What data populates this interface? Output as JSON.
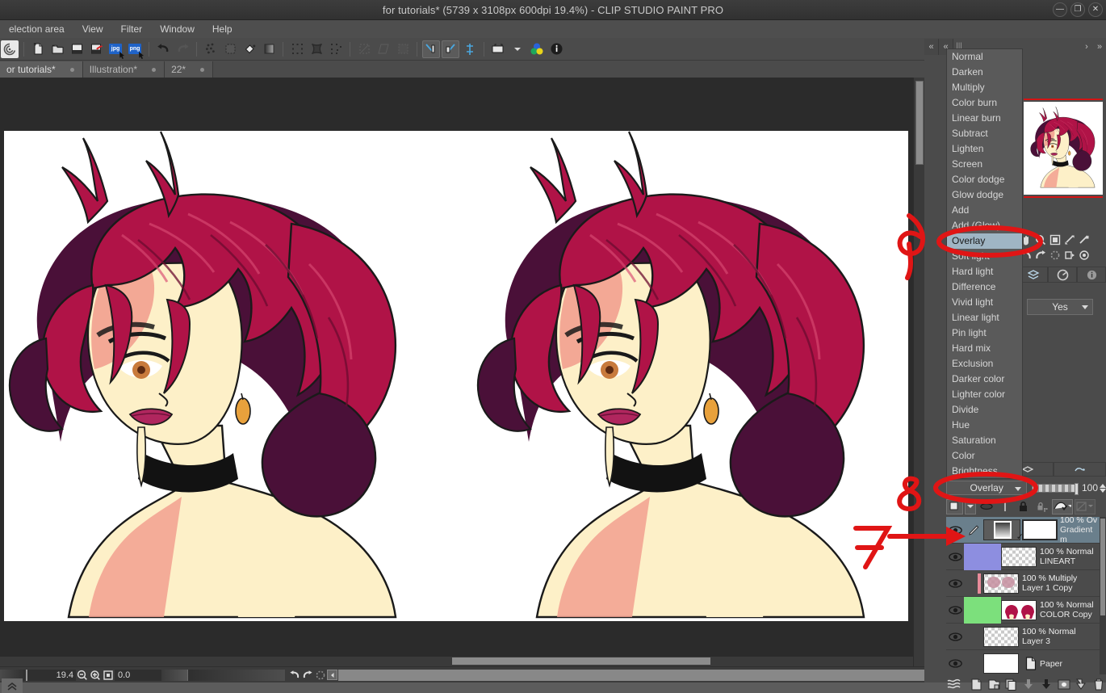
{
  "window": {
    "title": "for tutorials* (5739 x 3108px 600dpi 19.4%)  - CLIP STUDIO PAINT PRO",
    "controls": {
      "minimize": "—",
      "maximize": "❐",
      "close": "✕"
    }
  },
  "menubar": {
    "items": [
      {
        "label": "election area"
      },
      {
        "label": "View"
      },
      {
        "label": "Filter"
      },
      {
        "label": "Window"
      },
      {
        "label": "Help"
      }
    ]
  },
  "commandbar": {
    "icons": [
      "clipstudio-logo-icon",
      "new-file-icon",
      "open-folder-icon",
      "save-icon",
      "save-as-icon",
      "export-jpg-icon",
      "export-png-icon",
      "undo-icon",
      "redo-icon",
      "clear-icon",
      "fill-selection-icon",
      "fill-bucket-icon",
      "gradient-icon",
      "select-all-icon",
      "deselect-icon",
      "invert-selection-icon",
      "shrink-selection-icon",
      "grow-selection-icon",
      "selection-border-icon",
      "flip-horizontal-icon",
      "flip-vertical-icon",
      "ruler-snap-icon",
      "canvas-preset-icon",
      "color-wheel-icon",
      "info-icon"
    ],
    "jpg_label": "jpg",
    "png_label": "png"
  },
  "doctabs": [
    {
      "label": "or tutorials*",
      "active": true
    },
    {
      "label": "Illustration*",
      "active": false
    },
    {
      "label": "22*",
      "active": false
    }
  ],
  "statusbar": {
    "zoom": "19.4",
    "rotation": "0.0",
    "zoom_out_icon": "zoom-out-icon",
    "zoom_fit_icon": "fit-to-screen-icon",
    "actual_size_icon": "actual-pixel-icon",
    "rotate_left_icon": "rotate-left-icon",
    "rotate_right_icon": "rotate-right-icon",
    "reset_rotation_icon": "reset-rotation-icon"
  },
  "blend_dropdown": {
    "selected": "Overlay",
    "items": [
      "Normal",
      "Darken",
      "Multiply",
      "Color burn",
      "Linear burn",
      "Subtract",
      "Lighten",
      "Screen",
      "Color dodge",
      "Glow dodge",
      "Add",
      "Add (Glow)",
      "Overlay",
      "Soft light",
      "Hard light",
      "Difference",
      "Vivid light",
      "Linear light",
      "Pin light",
      "Hard mix",
      "Exclusion",
      "Darker color",
      "Lighter color",
      "Divide",
      "Hue",
      "Saturation",
      "Color",
      "Brightness"
    ]
  },
  "navigator": {
    "tool_detail_value": "Yes",
    "icons": [
      "hand-icon",
      "zoom-icon",
      "fit-canvas-icon",
      "flip-canvas-icon",
      "rotate-canvas-icon",
      "rotate-ccw-icon",
      "rotate-cw-icon",
      "reset-view-icon",
      "snapshot-icon",
      "record-icon"
    ],
    "tabs": [
      "layer-property-tab",
      "navigator-tab",
      "info-tab"
    ]
  },
  "layer_panel": {
    "blend_mode": "Overlay",
    "opacity": "100",
    "tool_icons": [
      "layer-color-icon",
      "palette-icon",
      "clip-below-icon",
      "ruler-icon",
      "lock-layer-icon",
      "lock-transparency-icon",
      "mask-enable-icon",
      "mask-disable-icon"
    ],
    "layers": [
      {
        "name": "Gradient m",
        "meta": "100 % Ov",
        "selected": true,
        "visible": true,
        "has_mask": true,
        "color_tag": "none"
      },
      {
        "name": "LINEART",
        "meta": "100 % Normal",
        "selected": false,
        "visible": true,
        "has_mask": false,
        "color_tag": "#8d8ee0"
      },
      {
        "name": "Layer 1 Copy",
        "meta": "100 % Multiply",
        "selected": false,
        "visible": true,
        "has_mask": false,
        "color_tag": "none"
      },
      {
        "name": "COLOR Copy",
        "meta": "100 % Normal",
        "selected": false,
        "visible": true,
        "has_mask": false,
        "color_tag": "#7ce07c"
      },
      {
        "name": "Layer 3",
        "meta": "100 % Normal",
        "selected": false,
        "visible": true,
        "has_mask": false,
        "color_tag": "none"
      },
      {
        "name": "Paper",
        "meta": "",
        "selected": false,
        "visible": true,
        "has_mask": false,
        "color_tag": "none"
      }
    ],
    "footer_icons": [
      "layer-palette-icon",
      "new-raster-layer-icon",
      "new-folder-icon",
      "duplicate-layer-icon",
      "merge-down-icon",
      "combine-icon",
      "layer-mask-icon",
      "transfer-icon",
      "delete-layer-icon"
    ]
  },
  "annotations": [
    {
      "id": "9",
      "label": "9",
      "target": "blend-dropdown-overlay"
    },
    {
      "id": "8",
      "label": "8",
      "target": "layer-blend-combo-overlay"
    },
    {
      "id": "7",
      "label": "7",
      "target": "gradient-map-layer-row"
    }
  ],
  "artwork": {
    "description": "Two side-by-side illustrations of a woman with crimson curly hair, cream skin, black choker",
    "hair_color": "#b01347",
    "hair_shadow": "#4a1038",
    "skin_color": "#fdf0c8",
    "skin_shadow": "#f2a08f",
    "lip_color": "#b0265e",
    "choker_color": "#121212",
    "earring_color": "#e8a13c"
  },
  "collapse": {
    "left": "«",
    "right": "«"
  }
}
